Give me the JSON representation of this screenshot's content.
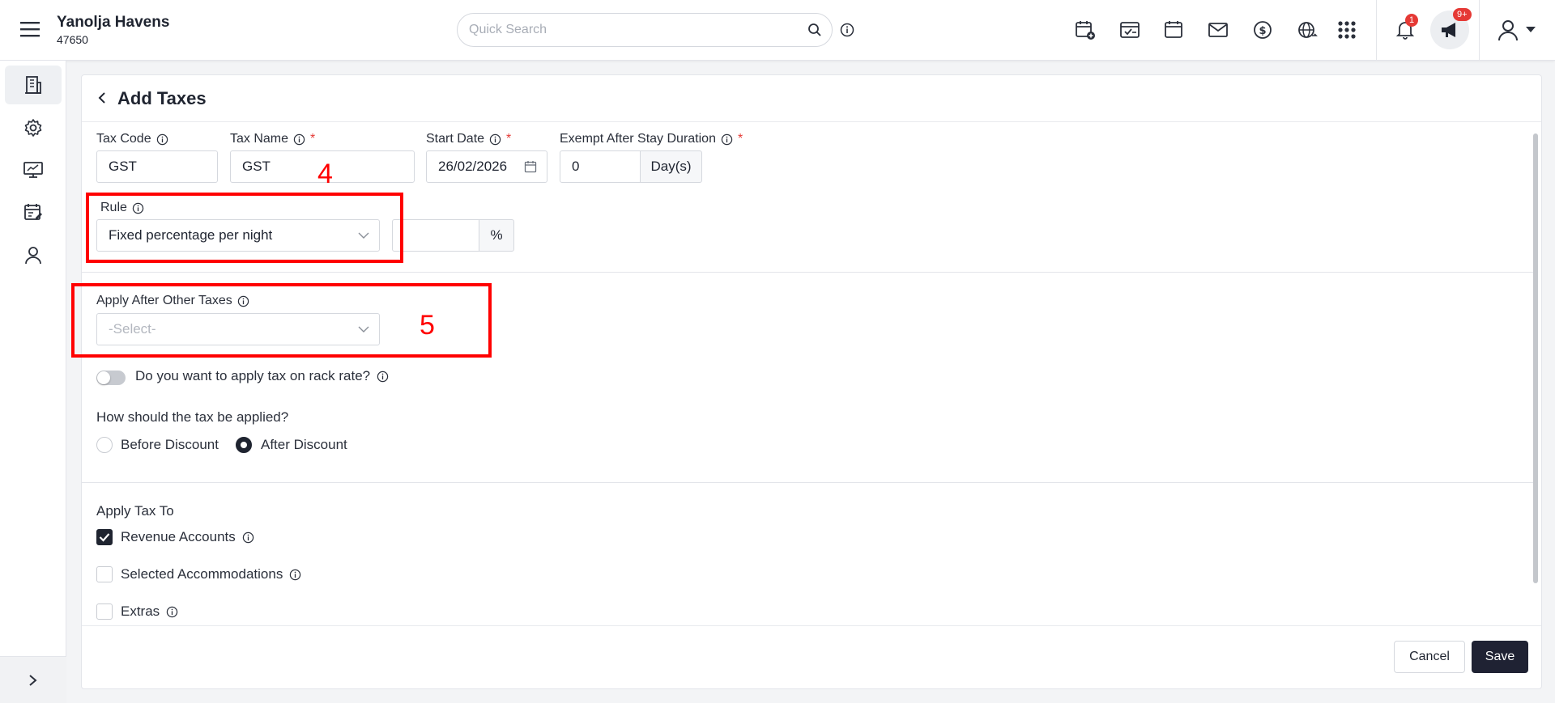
{
  "header": {
    "property_name": "Yanolja Havens",
    "property_id": "47650",
    "search_placeholder": "Quick Search",
    "notification_count": "1",
    "announcement_count": "9+"
  },
  "sidebar": {
    "items": [
      {
        "icon": "building-icon",
        "active": true
      },
      {
        "icon": "gear-icon"
      },
      {
        "icon": "monitor-icon"
      },
      {
        "icon": "calendar-edit-icon"
      },
      {
        "icon": "user-icon"
      }
    ],
    "expand_label": ">"
  },
  "page": {
    "title": "Add Taxes",
    "tax_code_label": "Tax Code",
    "tax_code_value": "GST",
    "tax_name_label": "Tax Name",
    "tax_name_value": "GST",
    "start_date_label": "Start Date",
    "start_date_value": "26/02/2026",
    "exempt_label": "Exempt After Stay Duration",
    "exempt_value": "0",
    "exempt_unit": "Day(s)",
    "rule_label": "Rule",
    "rule_value": "Fixed percentage per night",
    "rule_amount_value": "",
    "rule_unit": "%",
    "apply_after_label": "Apply After Other Taxes",
    "apply_after_placeholder": "-Select-",
    "rack_rate_label": "Do you want to apply tax on rack rate?",
    "rack_rate_on": false,
    "apply_method_label": "How should the tax be applied?",
    "apply_method_options": [
      "Before Discount",
      "After Discount"
    ],
    "apply_method_selected": "After Discount",
    "apply_to_label": "Apply Tax To",
    "apply_to_options": [
      {
        "label": "Revenue Accounts",
        "checked": true
      },
      {
        "label": "Selected Accommodations",
        "checked": false
      },
      {
        "label": "Extras",
        "checked": false
      }
    ]
  },
  "annotations": {
    "box4": "4",
    "box5": "5"
  },
  "footer": {
    "cancel_label": "Cancel",
    "save_label": "Save"
  },
  "colors": {
    "annotation": "#ff0000",
    "primary": "#1f2233",
    "badge": "#e53935"
  }
}
